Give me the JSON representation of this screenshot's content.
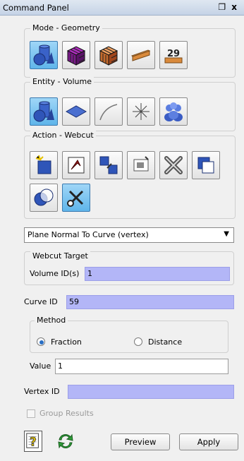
{
  "panel": {
    "title": "Command Panel",
    "controls": "❐ x"
  },
  "mode": {
    "legend": "Mode - Geometry"
  },
  "entity": {
    "legend": "Entity - Volume"
  },
  "action": {
    "legend": "Action - Webcut"
  },
  "webcut": {
    "method_select": "Plane Normal To Curve (vertex)",
    "target_legend": "Webcut Target",
    "volume_label": "Volume ID(s)",
    "volume_value": "1",
    "curve_label": "Curve ID",
    "curve_value": "59",
    "method_legend": "Method",
    "fraction_label": "Fraction",
    "distance_label": "Distance",
    "value_label": "Value",
    "value_value": "1",
    "vertex_label": "Vertex ID",
    "vertex_value": "",
    "group_results_label": "Group Results"
  },
  "footer": {
    "preview_label": "Preview",
    "apply_label": "Apply"
  }
}
